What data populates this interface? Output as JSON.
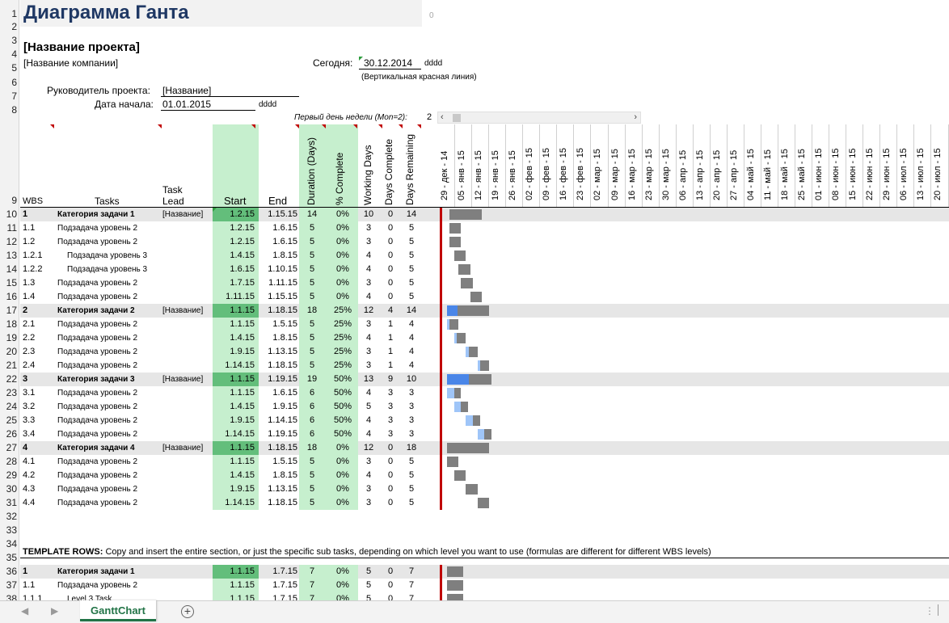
{
  "title": "Диаграмма Ганта",
  "title_zero": "0",
  "project_name": "[Название проекта]",
  "company_name": "[Название компании]",
  "today_label": "Сегодня:",
  "today_value": "30.12.2014",
  "today_format": "dddd",
  "today_note": "(Вертикальная красная линия)",
  "manager_label": "Руководитель проекта:",
  "manager_value": "[Название]",
  "start_label": "Дата начала:",
  "start_value": "01.01.2015",
  "start_format": "dddd",
  "first_day_label": "Первый день недели (Mon=2):",
  "first_day_value": "2",
  "row_numbers": [
    "1",
    "2",
    "3",
    "4",
    "5",
    "6",
    "7",
    "8",
    "9",
    "10",
    "11",
    "12",
    "13",
    "14",
    "15",
    "16",
    "17",
    "18",
    "19",
    "20",
    "21",
    "22",
    "23",
    "24",
    "25",
    "26",
    "27",
    "28",
    "29",
    "30",
    "31",
    "32",
    "33",
    "34",
    "35",
    "36",
    "37",
    "38"
  ],
  "headers": {
    "wbs": "WBS",
    "tasks": "Tasks",
    "lead_1": "Task",
    "lead_2": "Lead",
    "start": "Start",
    "end": "End",
    "duration": "Duration (Days)",
    "complete": "% Complete",
    "working": "Working Days",
    "days_complete": "Days Complete",
    "days_remaining": "Days Remaining"
  },
  "date_headers": [
    "29 - дек - 14",
    "05 - янв - 15",
    "12 - янв - 15",
    "19 - янв - 15",
    "26 - янв - 15",
    "02 - фев - 15",
    "09 - фев - 15",
    "16 - фев - 15",
    "23 - фев - 15",
    "02 - мар - 15",
    "09 - мар - 15",
    "16 - мар - 15",
    "23 - мар - 15",
    "30 - мар - 15",
    "06 - апр - 15",
    "13 - апр - 15",
    "20 - апр - 15",
    "27 - апр - 15",
    "04 - май - 15",
    "11 - май - 15",
    "18 - май - 15",
    "25 - май - 15",
    "01 - июн - 15",
    "08 - июн - 15",
    "15 - июн - 15",
    "22 - июн - 15",
    "29 - июн - 15",
    "06 - июл - 15",
    "13 - июл - 15",
    "20 - июл - 15"
  ],
  "tasks": [
    {
      "row": 10,
      "wbs": "1",
      "name": "Категория задачи 1",
      "lead": "[Название]",
      "start": "1.2.15",
      "end": "1.15.15",
      "dur": "14",
      "pct": "0%",
      "work": "10",
      "done": "0",
      "rem": "14",
      "level": 0
    },
    {
      "row": 11,
      "wbs": "1.1",
      "name": "Подзадача уровень 2",
      "lead": "",
      "start": "1.2.15",
      "end": "1.6.15",
      "dur": "5",
      "pct": "0%",
      "work": "3",
      "done": "0",
      "rem": "5",
      "level": 1
    },
    {
      "row": 12,
      "wbs": "1.2",
      "name": "Подзадача уровень 2",
      "lead": "",
      "start": "1.2.15",
      "end": "1.6.15",
      "dur": "5",
      "pct": "0%",
      "work": "3",
      "done": "0",
      "rem": "5",
      "level": 1
    },
    {
      "row": 13,
      "wbs": "1.2.1",
      "name": "Подзадача уровень 3",
      "lead": "",
      "start": "1.4.15",
      "end": "1.8.15",
      "dur": "5",
      "pct": "0%",
      "work": "4",
      "done": "0",
      "rem": "5",
      "level": 2
    },
    {
      "row": 14,
      "wbs": "1.2.2",
      "name": "Подзадача уровень 3",
      "lead": "",
      "start": "1.6.15",
      "end": "1.10.15",
      "dur": "5",
      "pct": "0%",
      "work": "4",
      "done": "0",
      "rem": "5",
      "level": 2
    },
    {
      "row": 15,
      "wbs": "1.3",
      "name": "Подзадача уровень 2",
      "lead": "",
      "start": "1.7.15",
      "end": "1.11.15",
      "dur": "5",
      "pct": "0%",
      "work": "3",
      "done": "0",
      "rem": "5",
      "level": 1
    },
    {
      "row": 16,
      "wbs": "1.4",
      "name": "Подзадача уровень 2",
      "lead": "",
      "start": "1.11.15",
      "end": "1.15.15",
      "dur": "5",
      "pct": "0%",
      "work": "4",
      "done": "0",
      "rem": "5",
      "level": 1
    },
    {
      "row": 17,
      "wbs": "2",
      "name": "Категория задачи 2",
      "lead": "[Название]",
      "start": "1.1.15",
      "end": "1.18.15",
      "dur": "18",
      "pct": "25%",
      "work": "12",
      "done": "4",
      "rem": "14",
      "level": 0
    },
    {
      "row": 18,
      "wbs": "2.1",
      "name": "Подзадача уровень 2",
      "lead": "",
      "start": "1.1.15",
      "end": "1.5.15",
      "dur": "5",
      "pct": "25%",
      "work": "3",
      "done": "1",
      "rem": "4",
      "level": 1
    },
    {
      "row": 19,
      "wbs": "2.2",
      "name": "Подзадача уровень 2",
      "lead": "",
      "start": "1.4.15",
      "end": "1.8.15",
      "dur": "5",
      "pct": "25%",
      "work": "4",
      "done": "1",
      "rem": "4",
      "level": 1
    },
    {
      "row": 20,
      "wbs": "2.3",
      "name": "Подзадача уровень 2",
      "lead": "",
      "start": "1.9.15",
      "end": "1.13.15",
      "dur": "5",
      "pct": "25%",
      "work": "3",
      "done": "1",
      "rem": "4",
      "level": 1
    },
    {
      "row": 21,
      "wbs": "2.4",
      "name": "Подзадача уровень 2",
      "lead": "",
      "start": "1.14.15",
      "end": "1.18.15",
      "dur": "5",
      "pct": "25%",
      "work": "3",
      "done": "1",
      "rem": "4",
      "level": 1
    },
    {
      "row": 22,
      "wbs": "3",
      "name": "Категория задачи 3",
      "lead": "[Название]",
      "start": "1.1.15",
      "end": "1.19.15",
      "dur": "19",
      "pct": "50%",
      "work": "13",
      "done": "9",
      "rem": "10",
      "level": 0
    },
    {
      "row": 23,
      "wbs": "3.1",
      "name": "Подзадача уровень 2",
      "lead": "",
      "start": "1.1.15",
      "end": "1.6.15",
      "dur": "6",
      "pct": "50%",
      "work": "4",
      "done": "3",
      "rem": "3",
      "level": 1
    },
    {
      "row": 24,
      "wbs": "3.2",
      "name": "Подзадача уровень 2",
      "lead": "",
      "start": "1.4.15",
      "end": "1.9.15",
      "dur": "6",
      "pct": "50%",
      "work": "5",
      "done": "3",
      "rem": "3",
      "level": 1
    },
    {
      "row": 25,
      "wbs": "3.3",
      "name": "Подзадача уровень 2",
      "lead": "",
      "start": "1.9.15",
      "end": "1.14.15",
      "dur": "6",
      "pct": "50%",
      "work": "4",
      "done": "3",
      "rem": "3",
      "level": 1
    },
    {
      "row": 26,
      "wbs": "3.4",
      "name": "Подзадача уровень 2",
      "lead": "",
      "start": "1.14.15",
      "end": "1.19.15",
      "dur": "6",
      "pct": "50%",
      "work": "4",
      "done": "3",
      "rem": "3",
      "level": 1
    },
    {
      "row": 27,
      "wbs": "4",
      "name": "Категория задачи 4",
      "lead": "[Название]",
      "start": "1.1.15",
      "end": "1.18.15",
      "dur": "18",
      "pct": "0%",
      "work": "12",
      "done": "0",
      "rem": "18",
      "level": 0
    },
    {
      "row": 28,
      "wbs": "4.1",
      "name": "Подзадача уровень 2",
      "lead": "",
      "start": "1.1.15",
      "end": "1.5.15",
      "dur": "5",
      "pct": "0%",
      "work": "3",
      "done": "0",
      "rem": "5",
      "level": 1
    },
    {
      "row": 29,
      "wbs": "4.2",
      "name": "Подзадача уровень 2",
      "lead": "",
      "start": "1.4.15",
      "end": "1.8.15",
      "dur": "5",
      "pct": "0%",
      "work": "4",
      "done": "0",
      "rem": "5",
      "level": 1
    },
    {
      "row": 30,
      "wbs": "4.3",
      "name": "Подзадача уровень 2",
      "lead": "",
      "start": "1.9.15",
      "end": "1.13.15",
      "dur": "5",
      "pct": "0%",
      "work": "3",
      "done": "0",
      "rem": "5",
      "level": 1
    },
    {
      "row": 31,
      "wbs": "4.4",
      "name": "Подзадача уровень 2",
      "lead": "",
      "start": "1.14.15",
      "end": "1.18.15",
      "dur": "5",
      "pct": "0%",
      "work": "3",
      "done": "0",
      "rem": "5",
      "level": 1
    },
    {
      "row": 36,
      "wbs": "1",
      "name": "Категория задачи 1",
      "lead": "",
      "start": "1.1.15",
      "end": "1.7.15",
      "dur": "7",
      "pct": "0%",
      "work": "5",
      "done": "0",
      "rem": "7",
      "level": 0
    },
    {
      "row": 37,
      "wbs": "1.1",
      "name": "Подзадача уровень 2",
      "lead": "",
      "start": "1.1.15",
      "end": "1.7.15",
      "dur": "7",
      "pct": "0%",
      "work": "5",
      "done": "0",
      "rem": "7",
      "level": 1
    },
    {
      "row": 38,
      "wbs": "1.1.1",
      "name": "Level 3 Task",
      "lead": "",
      "start": "1.1.15",
      "end": "1.7.15",
      "dur": "7",
      "pct": "0%",
      "work": "5",
      "done": "0",
      "rem": "7",
      "level": 2
    }
  ],
  "template_label_bold": "TEMPLATE ROWS:",
  "template_label_rest": " Copy and insert the entire section, or just the specific sub tasks, depending on which level you want to use (formulas are different for different WBS levels)",
  "sheet_tab": "GanttChart",
  "colors": {
    "title": "#1f3864",
    "start_col": "#c6efce",
    "start_hdr": "#63be7b",
    "summary_row": "#e6e6e6",
    "bar_gray": "#7f7f7f",
    "bar_done": "#4a86e8",
    "bar_done_light": "#9fc5f8",
    "today_line": "#c00000",
    "tab_text": "#217346"
  }
}
